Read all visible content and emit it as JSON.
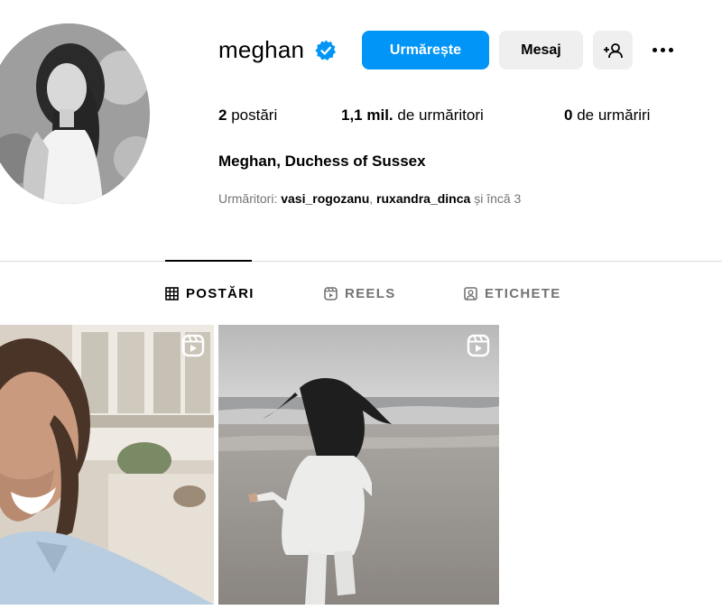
{
  "profile": {
    "username": "meghan",
    "full_name": "Meghan, Duchess of Sussex",
    "verified": true
  },
  "actions": {
    "follow_label": "Urmărește",
    "message_label": "Mesaj",
    "suggest_icon": "person-plus-icon",
    "more_icon": "more-options-icon"
  },
  "stats": {
    "posts_count": "2",
    "posts_label": "postări",
    "followers_count": "1,1 mil.",
    "followers_label": "de urmăritori",
    "following_count": "0",
    "following_label": "de urmăriri"
  },
  "followed_by": {
    "prefix": "Urmăritori:",
    "users": [
      "vasi_rogozanu",
      "ruxandra_dinca"
    ],
    "separator": ",",
    "suffix": "și încă 3"
  },
  "tabs": [
    {
      "label": "POSTĂRI",
      "icon": "grid-icon",
      "active": true
    },
    {
      "label": "REELS",
      "icon": "reels-icon",
      "active": false
    },
    {
      "label": "ETICHETE",
      "icon": "tagged-icon",
      "active": false
    }
  ],
  "posts": [
    {
      "type": "reel",
      "icon": "reel-icon"
    },
    {
      "type": "reel",
      "icon": "reel-icon"
    }
  ],
  "colors": {
    "accent": "#0095f6",
    "secondary_button": "#efefef",
    "muted_text": "#737373",
    "divider": "#dbdbdb"
  }
}
